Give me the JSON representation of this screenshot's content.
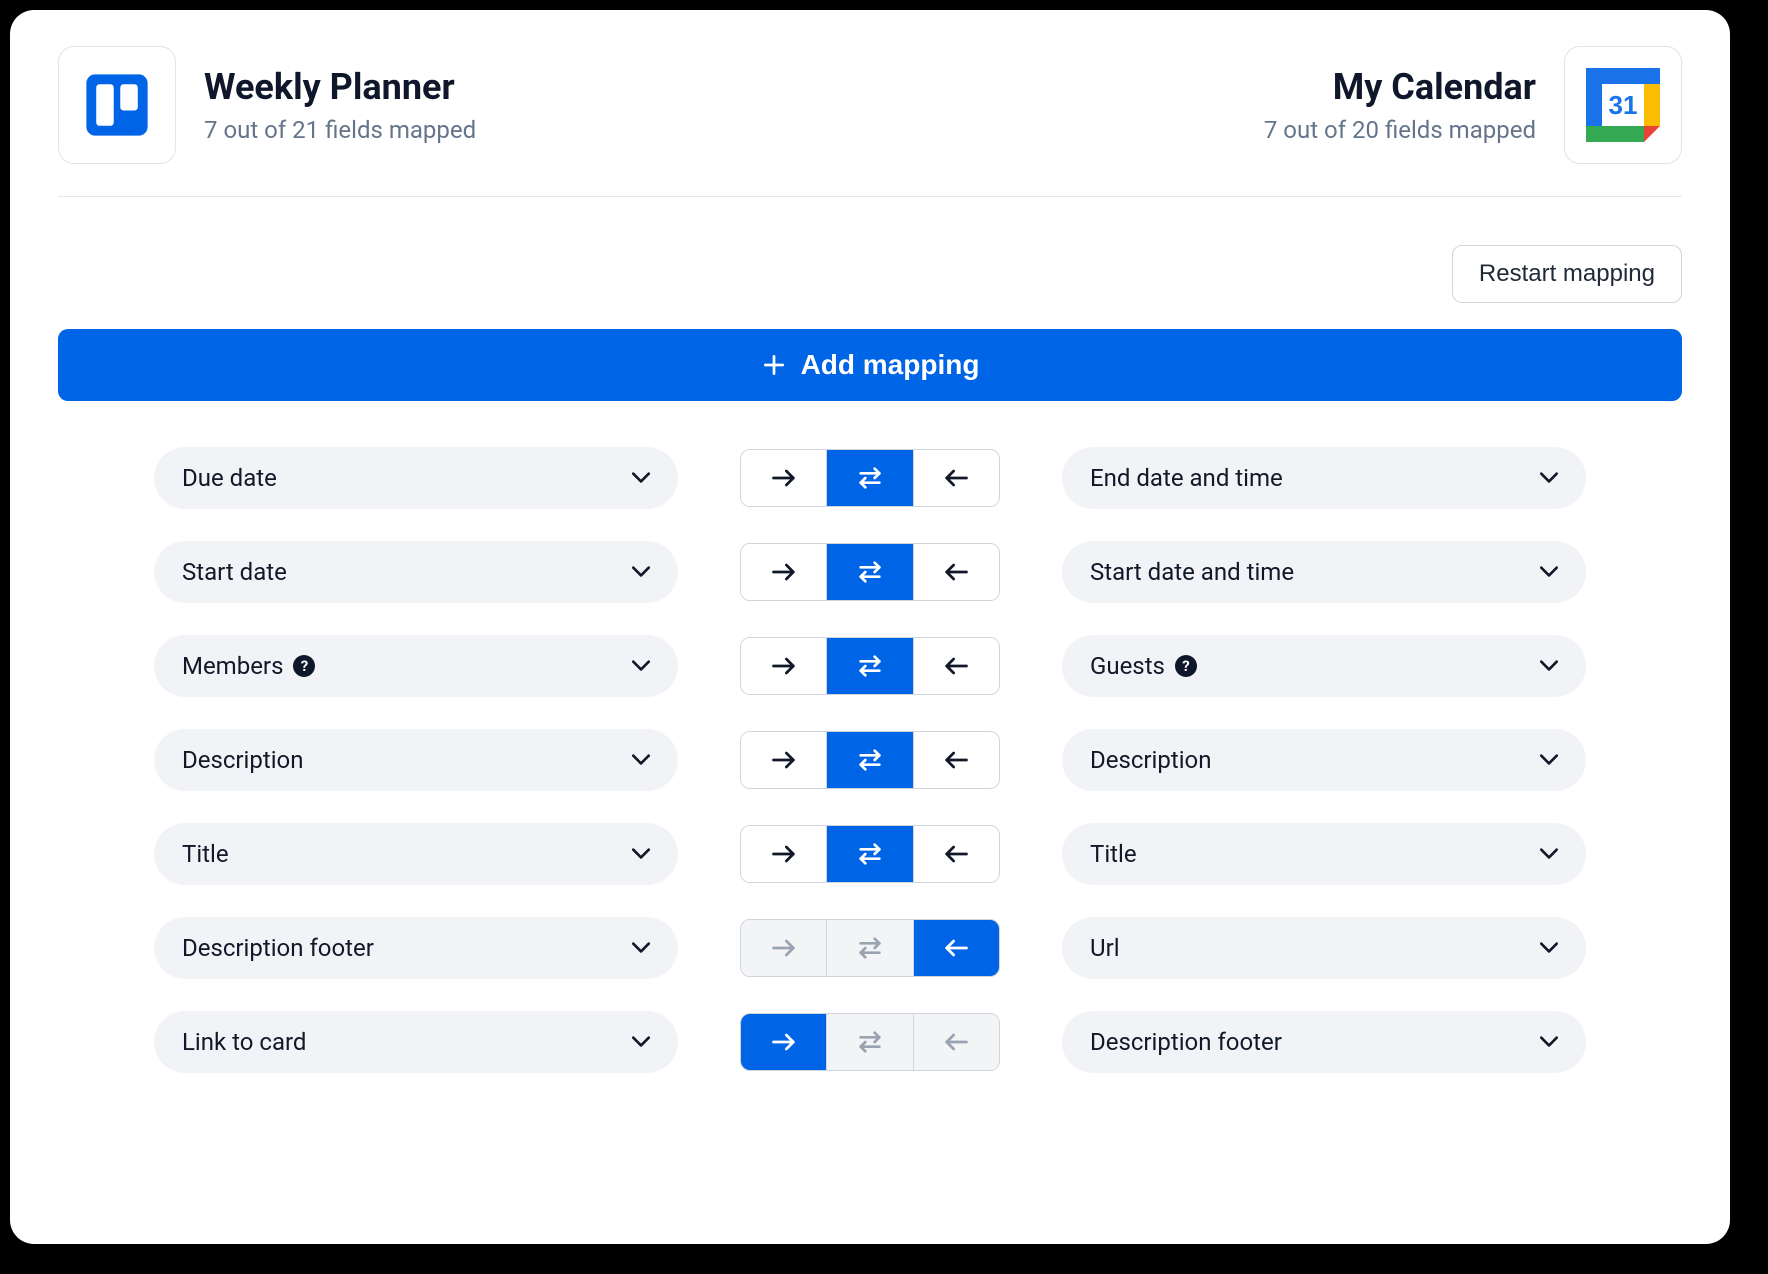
{
  "left_app": {
    "title": "Weekly Planner",
    "subtitle": "7 out of 21 fields mapped",
    "icon": "trello"
  },
  "right_app": {
    "title": "My Calendar",
    "subtitle": "7 out of 20 fields mapped",
    "icon": "google-calendar",
    "icon_day": "31"
  },
  "toolbar": {
    "restart_label": "Restart mapping",
    "add_label": "Add mapping"
  },
  "mappings": [
    {
      "left": "Due date",
      "left_help": false,
      "right": "End date and time",
      "right_help": false,
      "direction": "both"
    },
    {
      "left": "Start date",
      "left_help": false,
      "right": "Start date and time",
      "right_help": false,
      "direction": "both"
    },
    {
      "left": "Members",
      "left_help": true,
      "right": "Guests",
      "right_help": true,
      "direction": "both"
    },
    {
      "left": "Description",
      "left_help": false,
      "right": "Description",
      "right_help": false,
      "direction": "both"
    },
    {
      "left": "Title",
      "left_help": false,
      "right": "Title",
      "right_help": false,
      "direction": "both"
    },
    {
      "left": "Description footer",
      "left_help": false,
      "right": "Url",
      "right_help": false,
      "direction": "left"
    },
    {
      "left": "Link to card",
      "left_help": false,
      "right": "Description footer",
      "right_help": false,
      "direction": "right"
    }
  ],
  "colors": {
    "primary": "#0064e6"
  }
}
